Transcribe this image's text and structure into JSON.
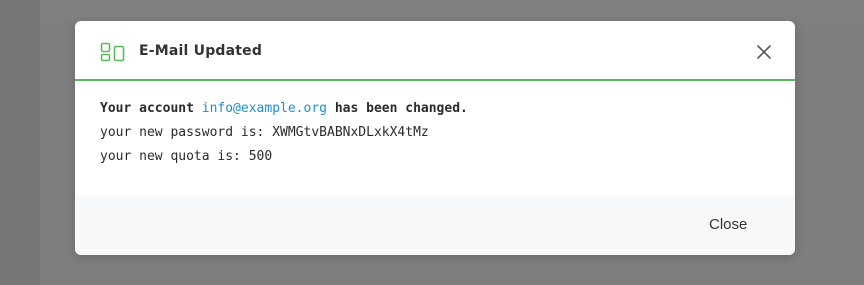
{
  "modal": {
    "title": "E-Mail Updated",
    "icon": "layout-panels-icon",
    "close_icon": "close-x-icon",
    "accent_color": "#5cb85c"
  },
  "message": {
    "line1_prefix": "Your account",
    "line1_email": "info@example.org",
    "line1_suffix": "has been changed.",
    "line2_label": "your new password is:",
    "line2_value": "XWMGtvBABNxDLxkX4tMz",
    "line3_label": "your new quota is:",
    "line3_value": "500",
    "link_color": "#1d8fce"
  },
  "footer": {
    "close_label": "Close"
  }
}
